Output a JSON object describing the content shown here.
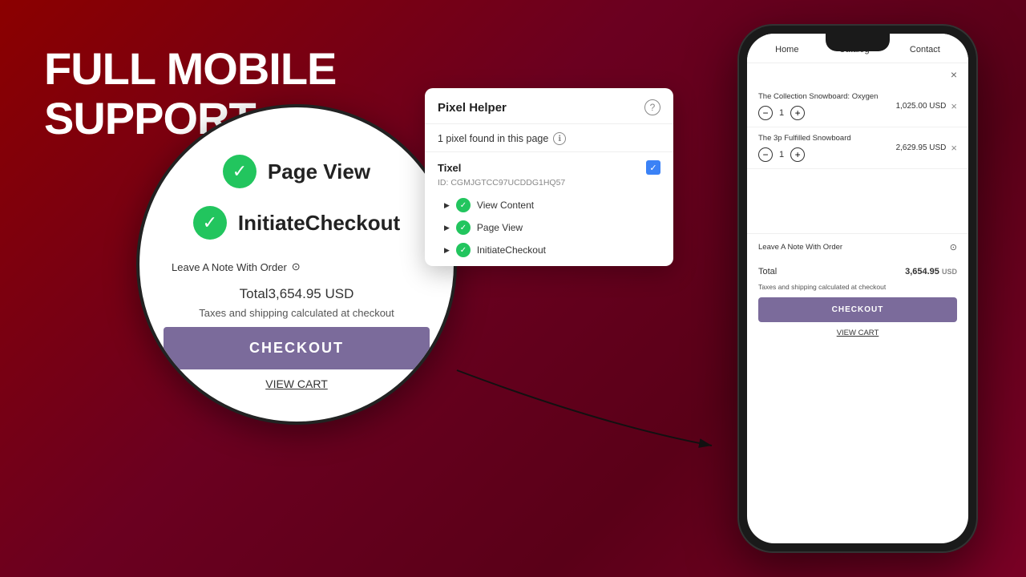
{
  "page": {
    "title": "FULL MOBILE\nSUPPORT",
    "background": "#8B0020"
  },
  "title_line1": "FULL MOBILE",
  "title_line2": "SUPPORT",
  "phone": {
    "nav": {
      "home": "Home",
      "catalog": "Catalog",
      "contact": "Contact"
    },
    "products": [
      {
        "name": "The Collection Snowboard: Oxygen",
        "qty": "1",
        "price": "1,025.00 USD"
      },
      {
        "name": "The 3p Fulfilled Snowboard",
        "qty": "1",
        "price": "2,629.95 USD"
      }
    ],
    "note_label": "Leave A Note With Order",
    "total_label": "Total",
    "total_value": "3,654.95",
    "total_currency": "USD",
    "tax_note": "Taxes and shipping calculated at checkout",
    "checkout_btn": "CHECKOUT",
    "view_cart": "VIEW CART"
  },
  "zoom": {
    "events": [
      {
        "label": "Page View"
      },
      {
        "label": "InitiateCheckout"
      }
    ],
    "note_label": "Leave A Note With Order",
    "total_label": "Total",
    "total_value": "3,654.95 USD",
    "tax_note": "Taxes and shipping calculated at checkout",
    "checkout_btn": "CHECKOUT",
    "view_cart": "VIEW CART"
  },
  "pixel_helper": {
    "title": "Pixel Helper",
    "found_text": "1 pixel found in this page",
    "pixel_name": "Tixel",
    "pixel_id": "ID: CGMJGTCC97UCDDG1HQ57",
    "events": [
      {
        "name": "View Content"
      },
      {
        "name": "Page View"
      },
      {
        "name": "InitiateCheckout"
      }
    ]
  }
}
